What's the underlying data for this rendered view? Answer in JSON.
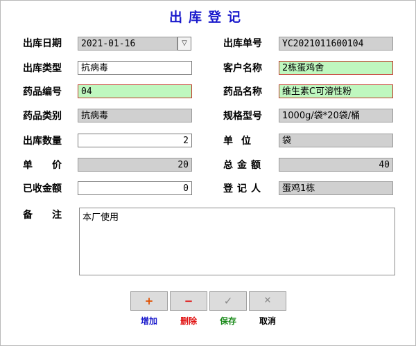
{
  "title": "出库登记",
  "colors": {
    "title": "#1a1acc",
    "highlight": "#bff7bf",
    "readonly": "#d0d0d0",
    "add": "#1a1acc",
    "delete": "#e01010",
    "save": "#1a8a1a"
  },
  "fields": {
    "out_date": {
      "label": "出库日期",
      "value": "2021-01-16"
    },
    "out_no": {
      "label": "出库单号",
      "value": "YC2021011600104"
    },
    "out_type": {
      "label": "出库类型",
      "value": "抗病毒"
    },
    "customer": {
      "label": "客户名称",
      "value": "2栋蛋鸡舍"
    },
    "drug_code": {
      "label": "药品编号",
      "value": "04"
    },
    "drug_name": {
      "label": "药品名称",
      "value": "维生素C可溶性粉"
    },
    "drug_category": {
      "label": "药品类别",
      "value": "抗病毒"
    },
    "spec": {
      "label": "规格型号",
      "value": "1000g/袋*20袋/桶"
    },
    "quantity": {
      "label": "出库数量",
      "value": "2"
    },
    "unit": {
      "label": "单位",
      "value": "袋"
    },
    "unit_price": {
      "label": "单价",
      "value": "20"
    },
    "total": {
      "label": "总金额",
      "value": "40"
    },
    "received": {
      "label": "已收金额",
      "value": "0"
    },
    "registrant": {
      "label": "登记人",
      "value": "蛋鸡1栋"
    },
    "remark": {
      "label": "备注",
      "value": "本厂使用"
    }
  },
  "buttons": {
    "add": {
      "icon": "plus-icon",
      "label": "增加"
    },
    "delete": {
      "icon": "minus-icon",
      "label": "删除"
    },
    "save": {
      "icon": "check-icon",
      "label": "保存"
    },
    "cancel": {
      "icon": "x-icon",
      "label": "取消"
    }
  }
}
